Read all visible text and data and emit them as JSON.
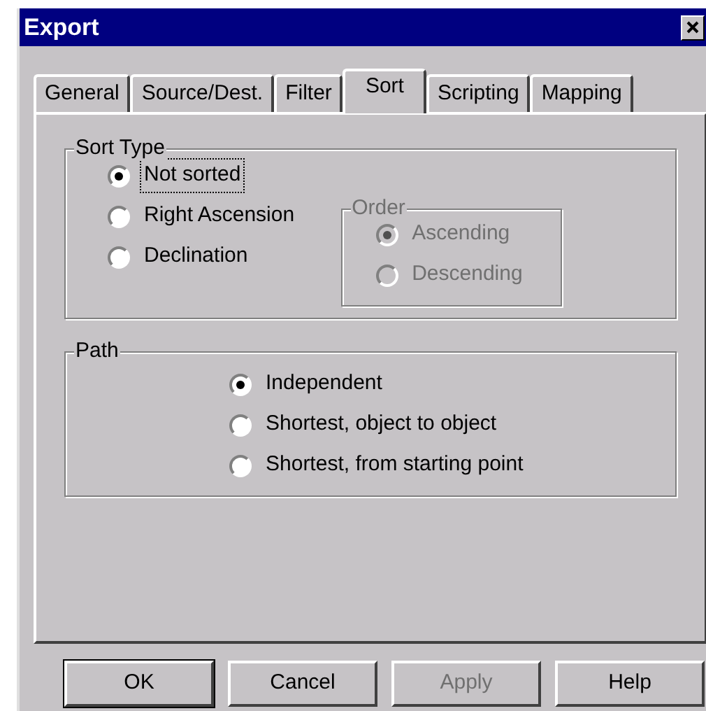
{
  "window": {
    "title": "Export"
  },
  "tabs": [
    {
      "label": "General",
      "selected": false
    },
    {
      "label": "Source/Dest.",
      "selected": false
    },
    {
      "label": "Filter",
      "selected": false
    },
    {
      "label": "Sort",
      "selected": true
    },
    {
      "label": "Scripting",
      "selected": false
    },
    {
      "label": "Mapping",
      "selected": false
    }
  ],
  "sort_type": {
    "label": "Sort Type",
    "options": [
      {
        "label": "Not sorted",
        "selected": true,
        "focused": true
      },
      {
        "label": "Right Ascension",
        "selected": false,
        "focused": false
      },
      {
        "label": "Declination",
        "selected": false,
        "focused": false
      }
    ]
  },
  "order": {
    "label": "Order",
    "disabled": true,
    "options": [
      {
        "label": "Ascending",
        "selected": true
      },
      {
        "label": "Descending",
        "selected": false
      }
    ]
  },
  "path": {
    "label": "Path",
    "options": [
      {
        "label": "Independent",
        "selected": true
      },
      {
        "label": "Shortest, object to object",
        "selected": false
      },
      {
        "label": "Shortest, from starting point",
        "selected": false
      }
    ]
  },
  "buttons": [
    {
      "label": "OK",
      "default": true,
      "disabled": false
    },
    {
      "label": "Cancel",
      "default": false,
      "disabled": false
    },
    {
      "label": "Apply",
      "default": false,
      "disabled": true
    },
    {
      "label": "Help",
      "default": false,
      "disabled": false
    }
  ]
}
